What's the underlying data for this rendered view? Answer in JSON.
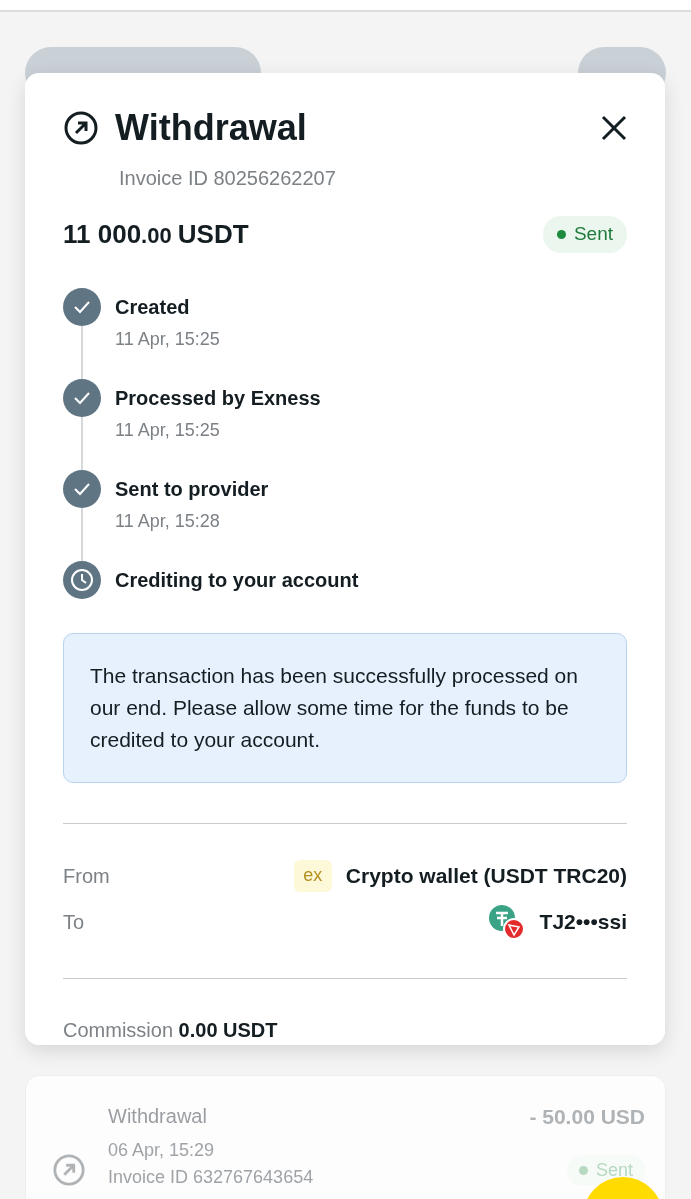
{
  "modal": {
    "title": "Withdrawal",
    "invoice": "Invoice ID 80256262207",
    "amount_main": "11 000",
    "amount_cents": ".00",
    "currency": "USDT",
    "status": "Sent",
    "steps": [
      {
        "label": "Created",
        "time": "11 Apr, 15:25",
        "done": true
      },
      {
        "label": "Processed by Exness",
        "time": "11 Apr, 15:25",
        "done": true
      },
      {
        "label": "Sent to provider",
        "time": "11 Apr, 15:28",
        "done": true
      },
      {
        "label": "Crediting to your account",
        "done": false
      }
    ],
    "notice": "The transaction has been successfully processed on our end. Please allow some time for the funds to be credited to your account.",
    "details": [
      {
        "label": "From",
        "logo": "ex",
        "value": "Crypto wallet (USDT TRC20)",
        "kind": "wallet"
      },
      {
        "label": "To",
        "value": "TJ2•••ssi",
        "kind": "address"
      }
    ],
    "commission": "Commission **0.00 USDT**"
  },
  "transactions": [
    {
      "title": "Withdrawal",
      "date": "06 Apr, 15:29",
      "invoice": "Invoice ID 632767643654",
      "amount": "- 50.00 USD",
      "status": "Sent"
    }
  ]
}
